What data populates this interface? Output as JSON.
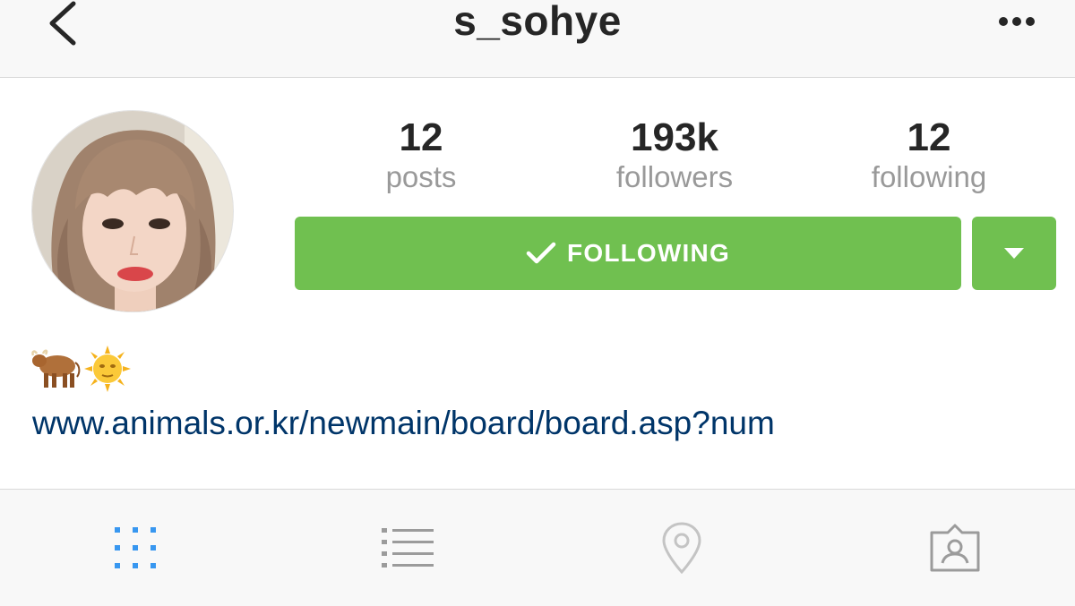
{
  "header": {
    "title": "s_sohye",
    "back_icon": "chevron-left-icon",
    "more_icon": "more-horizontal-icon"
  },
  "profile": {
    "avatar": "profile-photo",
    "stats": [
      {
        "value": "12",
        "label": "posts"
      },
      {
        "value": "193k",
        "label": "followers"
      },
      {
        "value": "12",
        "label": "following"
      }
    ],
    "follow_button": {
      "label": "FOLLOWING",
      "icon": "checkmark-icon"
    },
    "dropdown_icon": "triangle-down-icon",
    "bio": {
      "emoji": [
        "ox-emoji",
        "sun-with-face-emoji"
      ],
      "link": "www.animals.or.kr/newmain/board/board.asp?num"
    }
  },
  "tabs": [
    {
      "name": "grid-view",
      "icon": "grid-icon",
      "active": true
    },
    {
      "name": "list-view",
      "icon": "list-icon",
      "active": false
    },
    {
      "name": "map-view",
      "icon": "location-pin-icon",
      "active": false
    },
    {
      "name": "tagged-photos",
      "icon": "tagged-person-icon",
      "active": false
    }
  ],
  "colors": {
    "accent_green": "#70c050",
    "link_blue": "#003569",
    "active_tab_blue": "#3897f0",
    "inactive_tab_gray": "#9b9b9b"
  }
}
